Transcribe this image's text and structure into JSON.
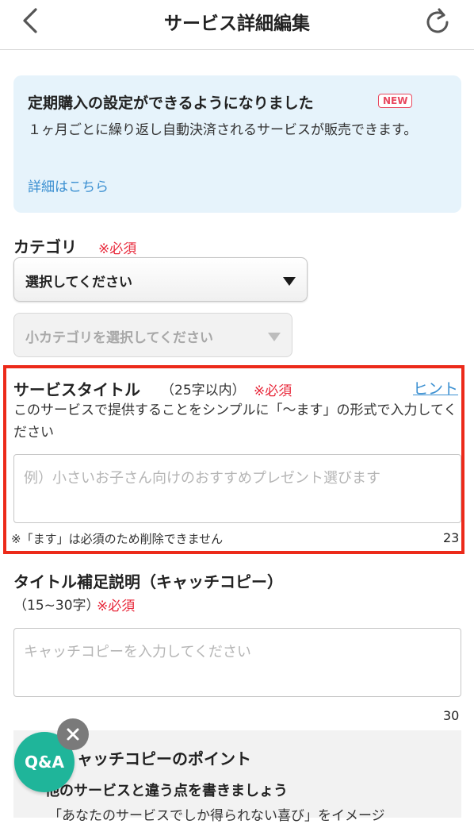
{
  "header": {
    "title": "サービス詳細編集",
    "back_icon": "chevron-left-icon",
    "reload_icon": "reload-icon"
  },
  "notice": {
    "title": "定期購入の設定ができるようになりました",
    "badge": "NEW",
    "body": "１ヶ月ごとに繰り返し自動決済されるサービスが販売できます。",
    "link": "詳細はこちら"
  },
  "category": {
    "label": "カテゴリ",
    "required": "※必須",
    "select_value": "選択してください",
    "sub_select_value": "小カテゴリを選択してください"
  },
  "service_title": {
    "label": "サービスタイトル",
    "limit": "（25字以内）",
    "required": "※必須",
    "hint": "ヒント",
    "description": "このサービスで提供することをシンプルに「〜ます」の形式で入力してください",
    "placeholder": "例）小さいお子さん向けのおすすめプレゼント選びます",
    "note": "※「ます」は必須のため削除できません",
    "count": "23"
  },
  "catch_copy": {
    "label": "タイトル補足説明（キャッチコピー）",
    "limit": "（15~30字）",
    "required": "※必須",
    "placeholder": "キャッチコピーを入力してください",
    "count": "30"
  },
  "tips": {
    "title": "ャッチコピーのポイント",
    "subtitle": "他のサービスと違う点を書きましょう",
    "body": "「あなたのサービスでしか得られない喜び」をイメージ"
  },
  "qa": {
    "label": "Q&A",
    "close_icon": "close-icon"
  },
  "colors": {
    "accent_red": "#e8283a",
    "link_blue": "#3a8fd1",
    "qa_green": "#1fb59a",
    "highlight_red": "#ec2a1a"
  }
}
